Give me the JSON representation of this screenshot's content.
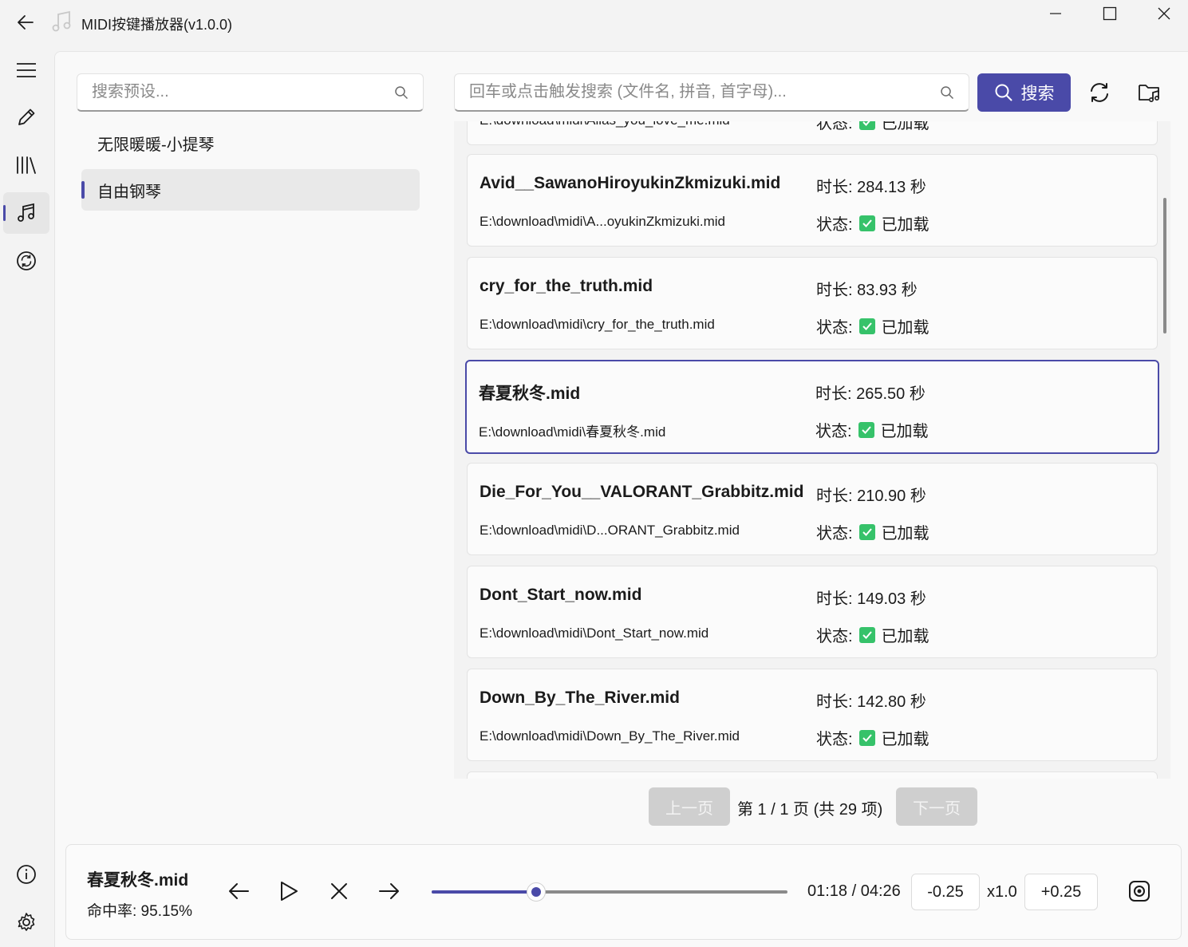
{
  "window": {
    "title": "MIDI按键播放器(v1.0.0)"
  },
  "nav": {
    "items": [
      "menu-icon",
      "edit-icon",
      "library-icon",
      "music-icon",
      "sync-icon",
      "info-icon",
      "settings-icon"
    ],
    "active": "music-icon"
  },
  "presets": {
    "search_placeholder": "搜索预设...",
    "items": [
      {
        "label": "无限暖暖-小提琴",
        "selected": false
      },
      {
        "label": "自由钢琴",
        "selected": true
      }
    ]
  },
  "files": {
    "search_placeholder": "回车或点击触发搜索 (文件名, 拼音, 首字母)...",
    "search_button": "搜索",
    "partial_top": {
      "path": "E:\\download\\midi\\Alias_you_love_me.mid",
      "status_label": "状态:",
      "status": "已加载"
    },
    "items": [
      {
        "name": "Avid__SawanoHiroyukinZkmizuki.mid",
        "path": "E:\\download\\midi\\A...oyukinZkmizuki.mid",
        "duration": "时长: 284.13 秒",
        "status_label": "状态:",
        "status": "已加载"
      },
      {
        "name": "cry_for_the_truth.mid",
        "path": "E:\\download\\midi\\cry_for_the_truth.mid",
        "duration": "时长: 83.93 秒",
        "status_label": "状态:",
        "status": "已加载"
      },
      {
        "name": "春夏秋冬.mid",
        "path": "E:\\download\\midi\\春夏秋冬.mid",
        "duration": "时长: 265.50 秒",
        "status_label": "状态:",
        "status": "已加载",
        "selected": true
      },
      {
        "name": "Die_For_You__VALORANT_Grabbitz.mid",
        "path": "E:\\download\\midi\\D...ORANT_Grabbitz.mid",
        "duration": "时长: 210.90 秒",
        "status_label": "状态:",
        "status": "已加载"
      },
      {
        "name": "Dont_Start_now.mid",
        "path": "E:\\download\\midi\\Dont_Start_now.mid",
        "duration": "时长: 149.03 秒",
        "status_label": "状态:",
        "status": "已加载"
      },
      {
        "name": "Down_By_The_River.mid",
        "path": "E:\\download\\midi\\Down_By_The_River.mid",
        "duration": "时长: 142.80 秒",
        "status_label": "状态:",
        "status": "已加载"
      }
    ]
  },
  "pagination": {
    "prev": "上一页",
    "info": "第 1 / 1 页 (共 29 项)",
    "next": "下一页"
  },
  "player": {
    "title": "春夏秋冬.mid",
    "hit_rate": "命中率: 95.15%",
    "progress": 0.294,
    "time": "01:18 / 04:26",
    "speed_down": "-0.25",
    "speed": "x1.0",
    "speed_up": "+0.25"
  },
  "colors": {
    "accent": "#4a4aa8",
    "check": "#36c26a"
  }
}
